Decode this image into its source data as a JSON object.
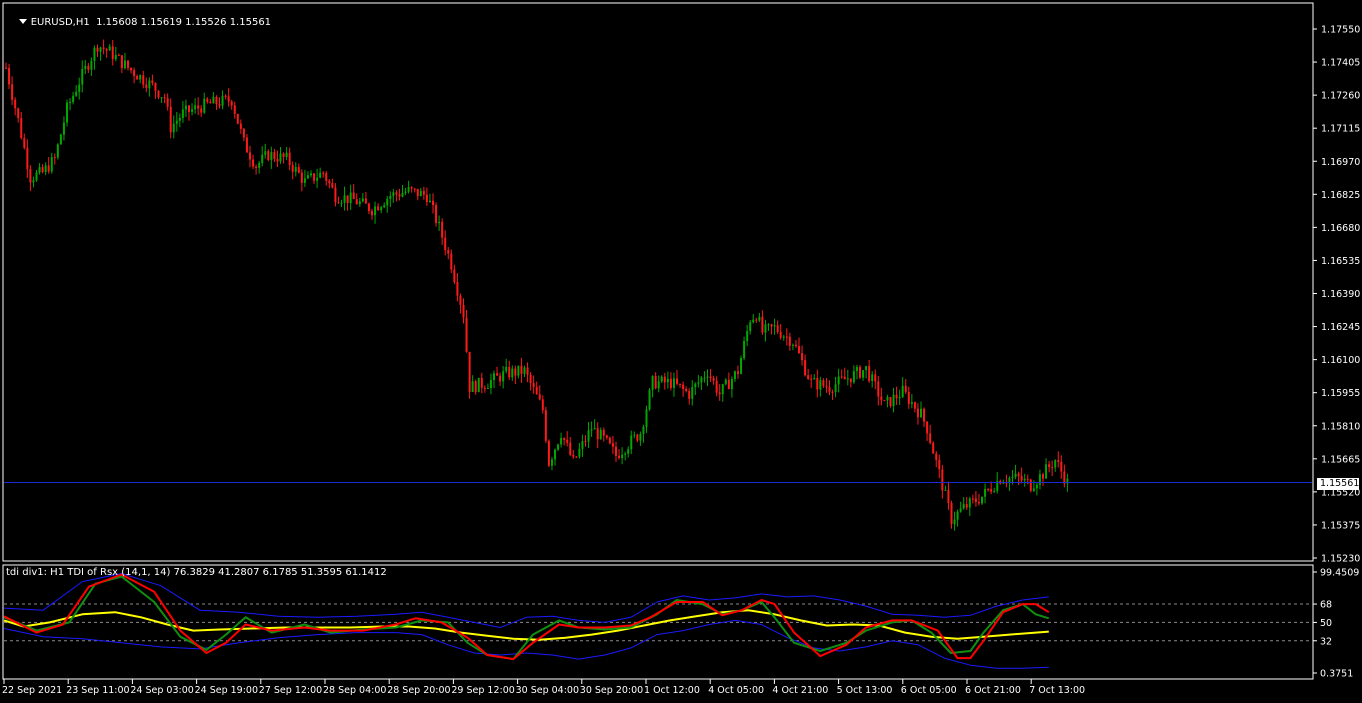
{
  "window": {
    "symbol_header": "EURUSD,H1",
    "ohlc_header": "1.15608 1.15619 1.15526 1.15561",
    "current_price": "1.15561"
  },
  "indicator": {
    "header_name": "tdi div1: H1 TDI of Rsx",
    "header_params": "(14,1, 14)",
    "header_values": "76.3829 41.2807 6.1785 51.3595 61.1412",
    "scale_labels": [
      "99.4509",
      "68",
      "50",
      "32",
      "0.3751"
    ],
    "levels": [
      68,
      50,
      32
    ],
    "scale_min": 0.3751,
    "scale_max": 99.4509
  },
  "price_axis": [
    "1.17550",
    "1.17405",
    "1.17260",
    "1.17115",
    "1.16970",
    "1.16825",
    "1.16680",
    "1.16535",
    "1.16390",
    "1.16245",
    "1.16100",
    "1.15955",
    "1.15810",
    "1.15665",
    "1.15520",
    "1.15375",
    "1.15230"
  ],
  "time_axis": [
    "22 Sep 2021",
    "23 Sep 11:00",
    "24 Sep 03:00",
    "24 Sep 19:00",
    "27 Sep 12:00",
    "28 Sep 04:00",
    "28 Sep 20:00",
    "29 Sep 12:00",
    "30 Sep 04:00",
    "30 Sep 20:00",
    "1 Oct 12:00",
    "4 Oct 05:00",
    "4 Oct 21:00",
    "5 Oct 13:00",
    "6 Oct 05:00",
    "6 Oct 21:00",
    "7 Oct 13:00"
  ],
  "colors": {
    "background": "#000000",
    "bull": "#00a800",
    "bear": "#ff1a1a",
    "grid_border": "#ffffff",
    "bid_line": "#1c2bd1",
    "tdi_price": "#0f8f0f",
    "tdi_signal": "#ff0000",
    "tdi_base": "#ffff00",
    "tdi_bands": "#1a1aff"
  },
  "chart_data": {
    "type": "candlestick",
    "timeframe": "H1",
    "ylim": [
      1.1523,
      1.1762
    ],
    "close_path": [
      [
        0,
        1.1738
      ],
      [
        2,
        1.1715
      ],
      [
        4,
        1.169
      ],
      [
        6,
        1.1692
      ],
      [
        8,
        1.1698
      ],
      [
        10,
        1.172
      ],
      [
        12,
        1.1732
      ],
      [
        15,
        1.1748
      ],
      [
        17,
        1.1745
      ],
      [
        20,
        1.1738
      ],
      [
        24,
        1.173
      ],
      [
        26,
        1.1725
      ],
      [
        27,
        1.1712
      ],
      [
        29,
        1.1718
      ],
      [
        33,
        1.1722
      ],
      [
        37,
        1.1724
      ],
      [
        39,
        1.1705
      ],
      [
        41,
        1.1695
      ],
      [
        43,
        1.17
      ],
      [
        46,
        1.1698
      ],
      [
        49,
        1.1688
      ],
      [
        52,
        1.1692
      ],
      [
        54,
        1.1682
      ],
      [
        57,
        1.168
      ],
      [
        60,
        1.1676
      ],
      [
        63,
        1.1682
      ],
      [
        66,
        1.1684
      ],
      [
        69,
        1.1682
      ],
      [
        71,
        1.1668
      ],
      [
        73,
        1.1652
      ],
      [
        75,
        1.163
      ],
      [
        76,
        1.1598
      ],
      [
        79,
        1.16
      ],
      [
        82,
        1.1604
      ],
      [
        85,
        1.1605
      ],
      [
        88,
        1.1588
      ],
      [
        89,
        1.1565
      ],
      [
        91,
        1.1578
      ],
      [
        93,
        1.1565
      ],
      [
        96,
        1.158
      ],
      [
        98,
        1.1575
      ],
      [
        100,
        1.1568
      ],
      [
        104,
        1.1578
      ],
      [
        106,
        1.16
      ],
      [
        109,
        1.16
      ],
      [
        112,
        1.1595
      ],
      [
        115,
        1.1605
      ],
      [
        117,
        1.1595
      ],
      [
        120,
        1.1605
      ],
      [
        122,
        1.1628
      ],
      [
        123,
        1.163
      ],
      [
        124,
        1.1622
      ],
      [
        126,
        1.1624
      ],
      [
        129,
        1.1618
      ],
      [
        132,
        1.16
      ],
      [
        135,
        1.1598
      ],
      [
        138,
        1.1602
      ],
      [
        141,
        1.1606
      ],
      [
        144,
        1.159
      ],
      [
        147,
        1.1596
      ],
      [
        150,
        1.1586
      ],
      [
        151,
        1.158
      ],
      [
        153,
        1.156
      ],
      [
        155,
        1.154
      ],
      [
        157,
        1.1545
      ],
      [
        160,
        1.155
      ],
      [
        163,
        1.1558
      ],
      [
        166,
        1.1558
      ],
      [
        168,
        1.1555
      ],
      [
        170,
        1.156
      ],
      [
        172,
        1.1566
      ],
      [
        174,
        1.1556
      ]
    ],
    "tdi_series": [
      {
        "name": "Price",
        "points": [
          [
            0,
            55
          ],
          [
            5,
            42
          ],
          [
            10,
            50
          ],
          [
            14,
            88
          ],
          [
            18,
            95
          ],
          [
            23,
            70
          ],
          [
            27,
            36
          ],
          [
            31,
            23
          ],
          [
            34,
            38
          ],
          [
            37,
            55
          ],
          [
            41,
            40
          ],
          [
            46,
            48
          ],
          [
            50,
            40
          ],
          [
            55,
            43
          ],
          [
            60,
            45
          ],
          [
            64,
            52
          ],
          [
            68,
            50
          ],
          [
            71,
            30
          ],
          [
            74,
            18
          ],
          [
            78,
            14
          ],
          [
            81,
            38
          ],
          [
            85,
            52
          ],
          [
            88,
            45
          ],
          [
            92,
            43
          ],
          [
            96,
            45
          ],
          [
            100,
            58
          ],
          [
            103,
            72
          ],
          [
            107,
            68
          ],
          [
            110,
            58
          ],
          [
            113,
            62
          ],
          [
            116,
            70
          ],
          [
            118,
            55
          ],
          [
            121,
            30
          ],
          [
            125,
            22
          ],
          [
            129,
            30
          ],
          [
            132,
            42
          ],
          [
            136,
            50
          ],
          [
            139,
            52
          ],
          [
            142,
            40
          ],
          [
            145,
            20
          ],
          [
            148,
            22
          ],
          [
            150,
            40
          ],
          [
            153,
            62
          ],
          [
            156,
            68
          ],
          [
            158,
            58
          ],
          [
            160,
            54
          ]
        ]
      },
      {
        "name": "Signal",
        "points": [
          [
            0,
            56
          ],
          [
            5,
            40
          ],
          [
            9,
            48
          ],
          [
            13,
            85
          ],
          [
            18,
            97
          ],
          [
            23,
            80
          ],
          [
            27,
            42
          ],
          [
            31,
            20
          ],
          [
            34,
            30
          ],
          [
            37,
            48
          ],
          [
            41,
            42
          ],
          [
            46,
            45
          ],
          [
            50,
            42
          ],
          [
            55,
            42
          ],
          [
            60,
            48
          ],
          [
            63,
            54
          ],
          [
            67,
            50
          ],
          [
            71,
            35
          ],
          [
            74,
            18
          ],
          [
            78,
            14
          ],
          [
            81,
            30
          ],
          [
            85,
            48
          ],
          [
            88,
            45
          ],
          [
            92,
            45
          ],
          [
            96,
            47
          ],
          [
            99,
            55
          ],
          [
            103,
            70
          ],
          [
            107,
            70
          ],
          [
            110,
            57
          ],
          [
            113,
            62
          ],
          [
            116,
            72
          ],
          [
            118,
            68
          ],
          [
            121,
            40
          ],
          [
            125,
            17
          ],
          [
            129,
            28
          ],
          [
            132,
            45
          ],
          [
            136,
            52
          ],
          [
            139,
            52
          ],
          [
            143,
            42
          ],
          [
            146,
            15
          ],
          [
            148,
            15
          ],
          [
            150,
            32
          ],
          [
            153,
            60
          ],
          [
            156,
            68
          ],
          [
            158,
            68
          ],
          [
            160,
            60
          ]
        ]
      },
      {
        "name": "Base",
        "points": [
          [
            0,
            52
          ],
          [
            3,
            46
          ],
          [
            7,
            50
          ],
          [
            12,
            58
          ],
          [
            17,
            60
          ],
          [
            21,
            55
          ],
          [
            25,
            48
          ],
          [
            29,
            42
          ],
          [
            33,
            43
          ],
          [
            38,
            44
          ],
          [
            43,
            45
          ],
          [
            48,
            45
          ],
          [
            53,
            45
          ],
          [
            58,
            46
          ],
          [
            62,
            46
          ],
          [
            66,
            44
          ],
          [
            70,
            40
          ],
          [
            74,
            37
          ],
          [
            78,
            34
          ],
          [
            82,
            33
          ],
          [
            86,
            35
          ],
          [
            90,
            38
          ],
          [
            94,
            42
          ],
          [
            98,
            47
          ],
          [
            102,
            52
          ],
          [
            106,
            56
          ],
          [
            110,
            60
          ],
          [
            114,
            62
          ],
          [
            118,
            58
          ],
          [
            122,
            52
          ],
          [
            126,
            47
          ],
          [
            130,
            48
          ],
          [
            134,
            47
          ],
          [
            138,
            40
          ],
          [
            142,
            36
          ],
          [
            146,
            34
          ],
          [
            150,
            36
          ],
          [
            154,
            38
          ],
          [
            158,
            40
          ],
          [
            160,
            41
          ]
        ]
      },
      {
        "name": "Upper Band",
        "points": [
          [
            0,
            64
          ],
          [
            6,
            62
          ],
          [
            12,
            90
          ],
          [
            18,
            98
          ],
          [
            24,
            86
          ],
          [
            30,
            62
          ],
          [
            36,
            60
          ],
          [
            42,
            56
          ],
          [
            48,
            55
          ],
          [
            54,
            56
          ],
          [
            60,
            58
          ],
          [
            64,
            60
          ],
          [
            68,
            55
          ],
          [
            72,
            50
          ],
          [
            76,
            45
          ],
          [
            80,
            55
          ],
          [
            84,
            56
          ],
          [
            88,
            52
          ],
          [
            92,
            50
          ],
          [
            96,
            55
          ],
          [
            100,
            70
          ],
          [
            104,
            76
          ],
          [
            108,
            72
          ],
          [
            112,
            74
          ],
          [
            116,
            78
          ],
          [
            120,
            75
          ],
          [
            124,
            76
          ],
          [
            128,
            72
          ],
          [
            132,
            66
          ],
          [
            136,
            58
          ],
          [
            140,
            57
          ],
          [
            144,
            55
          ],
          [
            148,
            57
          ],
          [
            152,
            66
          ],
          [
            156,
            72
          ],
          [
            160,
            75
          ]
        ]
      },
      {
        "name": "Lower Band",
        "points": [
          [
            0,
            44
          ],
          [
            6,
            36
          ],
          [
            12,
            34
          ],
          [
            18,
            30
          ],
          [
            24,
            26
          ],
          [
            30,
            24
          ],
          [
            36,
            30
          ],
          [
            42,
            35
          ],
          [
            48,
            38
          ],
          [
            54,
            40
          ],
          [
            60,
            40
          ],
          [
            64,
            38
          ],
          [
            68,
            28
          ],
          [
            72,
            20
          ],
          [
            76,
            18
          ],
          [
            80,
            20
          ],
          [
            84,
            18
          ],
          [
            88,
            14
          ],
          [
            92,
            18
          ],
          [
            96,
            25
          ],
          [
            100,
            38
          ],
          [
            104,
            42
          ],
          [
            108,
            48
          ],
          [
            112,
            52
          ],
          [
            116,
            48
          ],
          [
            120,
            35
          ],
          [
            124,
            25
          ],
          [
            128,
            22
          ],
          [
            132,
            26
          ],
          [
            136,
            32
          ],
          [
            140,
            28
          ],
          [
            144,
            15
          ],
          [
            148,
            8
          ],
          [
            152,
            5
          ],
          [
            156,
            5
          ],
          [
            160,
            6
          ]
        ]
      }
    ]
  }
}
